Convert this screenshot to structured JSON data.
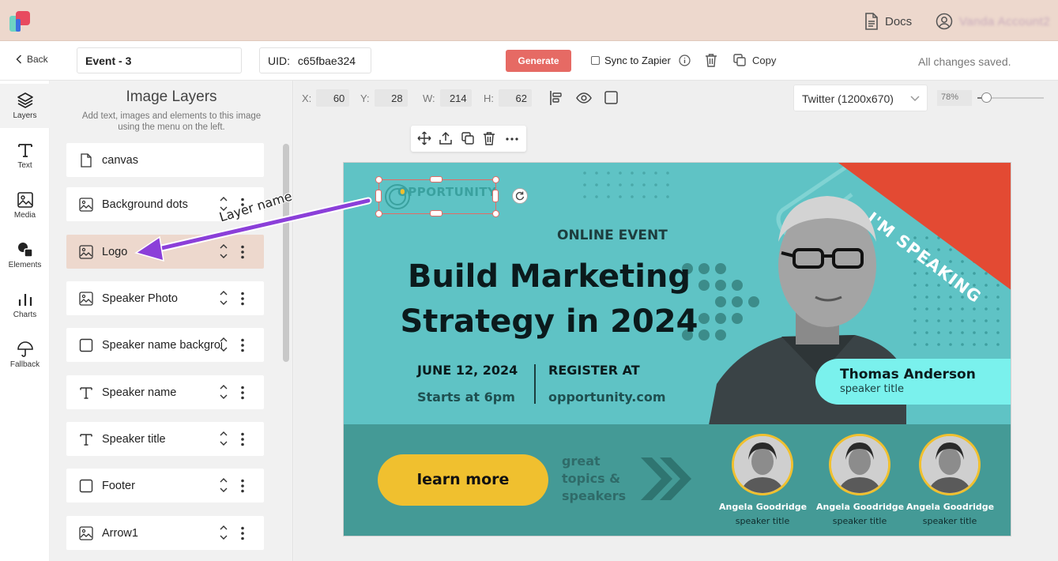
{
  "header": {
    "docs_label": "Docs",
    "account_label": "Vanda Account2"
  },
  "toolbar": {
    "back_label": "Back",
    "design_name": "Event - 3",
    "uid_label": "UID:",
    "uid_value": "c65fbae324",
    "generate_label": "Generate",
    "sync_label": "Sync to Zapier",
    "sync_checked": false,
    "copy_label": "Copy",
    "status": "All changes saved."
  },
  "rail": {
    "items": [
      {
        "label": "Layers",
        "icon": "layers-icon",
        "active": true
      },
      {
        "label": "Text",
        "icon": "text-icon"
      },
      {
        "label": "Media",
        "icon": "image-icon"
      },
      {
        "label": "Elements",
        "icon": "shapes-icon"
      },
      {
        "label": "Charts",
        "icon": "bar-chart-icon"
      },
      {
        "label": "Fallback",
        "icon": "umbrella-icon"
      }
    ]
  },
  "layers_panel": {
    "title": "Image Layers",
    "subtitle": "Add text, images and elements to this image using the menu on the left.",
    "layers": [
      {
        "name": "canvas",
        "icon": "file-icon",
        "controls": false
      },
      {
        "name": "Background dots",
        "icon": "image-icon",
        "controls": true
      },
      {
        "name": "Logo",
        "icon": "image-icon",
        "controls": true,
        "selected": true
      },
      {
        "name": "Speaker Photo",
        "icon": "image-icon",
        "controls": true
      },
      {
        "name": "Speaker name background",
        "icon": "square-icon",
        "controls": true
      },
      {
        "name": "Speaker name",
        "icon": "text-icon",
        "controls": true
      },
      {
        "name": "Speaker title",
        "icon": "text-icon",
        "controls": true
      },
      {
        "name": "Footer",
        "icon": "square-icon",
        "controls": true
      },
      {
        "name": "Arrow1",
        "icon": "image-icon",
        "controls": true
      }
    ]
  },
  "properties": {
    "x_label": "X:",
    "x_value": "60",
    "y_label": "Y:",
    "y_value": "28",
    "w_label": "W:",
    "w_value": "214",
    "h_label": "H:",
    "h_value": "62",
    "preset": "Twitter (1200x670)",
    "zoom": "78%",
    "zoom_level": 0.78
  },
  "annotation": {
    "label": "Layer name"
  },
  "canvas": {
    "logo_text": "OPPORTUNITY",
    "ribbon_text": "I'M SPEAKING",
    "eyebrow": "ONLINE EVENT",
    "headline_line1": "Build Marketing",
    "headline_line2": "Strategy in 2024",
    "date": "JUNE 12, 2024",
    "time": "Starts at 6pm",
    "register_label": "REGISTER AT",
    "register_url": "opportunity.com",
    "speaker_name": "Thomas Anderson",
    "speaker_title": "speaker title",
    "cta_label": "learn more",
    "tagline_1": "great",
    "tagline_2": "topics &",
    "tagline_3": "speakers",
    "speakers": [
      {
        "name": "Angela Goodridge",
        "title": "speaker title"
      },
      {
        "name": "Angela Goodridge",
        "title": "speaker title"
      },
      {
        "name": "Angela Goodridge",
        "title": "speaker title"
      }
    ],
    "colors": {
      "background": "#5fc3c5",
      "footer": "#449a96",
      "accent_red": "#e34a33",
      "cta": "#f0c02f",
      "namebox": "#7af1ed"
    }
  }
}
